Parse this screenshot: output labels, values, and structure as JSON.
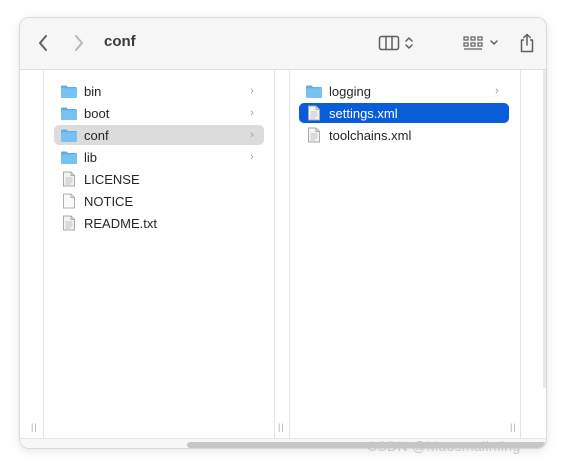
{
  "window": {
    "title": "conf"
  },
  "toolbar": {
    "back_icon": "chevron-left-icon",
    "forward_icon": "chevron-right-icon",
    "view_icon": "column-view-icon",
    "group_icon": "grid-group-icon",
    "share_icon": "share-icon"
  },
  "columns": {
    "left": [
      {
        "label": "bin",
        "type": "folder",
        "has_children": true
      },
      {
        "label": "boot",
        "type": "folder",
        "has_children": true
      },
      {
        "label": "conf",
        "type": "folder",
        "has_children": true,
        "state": "parent-selected"
      },
      {
        "label": "lib",
        "type": "folder",
        "has_children": true
      },
      {
        "label": "LICENSE",
        "type": "text-file",
        "has_children": false
      },
      {
        "label": "NOTICE",
        "type": "blank-file",
        "has_children": false
      },
      {
        "label": "README.txt",
        "type": "text-file",
        "has_children": false
      }
    ],
    "middle": [
      {
        "label": "logging",
        "type": "folder",
        "has_children": true
      },
      {
        "label": "settings.xml",
        "type": "text-file",
        "has_children": false,
        "state": "selected"
      },
      {
        "label": "toolchains.xml",
        "type": "text-file",
        "has_children": false
      }
    ]
  },
  "watermark": {
    "text": "CSDN @Maosmallming"
  },
  "colors": {
    "selection": "#0a5dd8",
    "parent_selection": "#dcdcdc",
    "folder": "#5aaeea",
    "toolbar_bg": "#f6f6f6"
  }
}
